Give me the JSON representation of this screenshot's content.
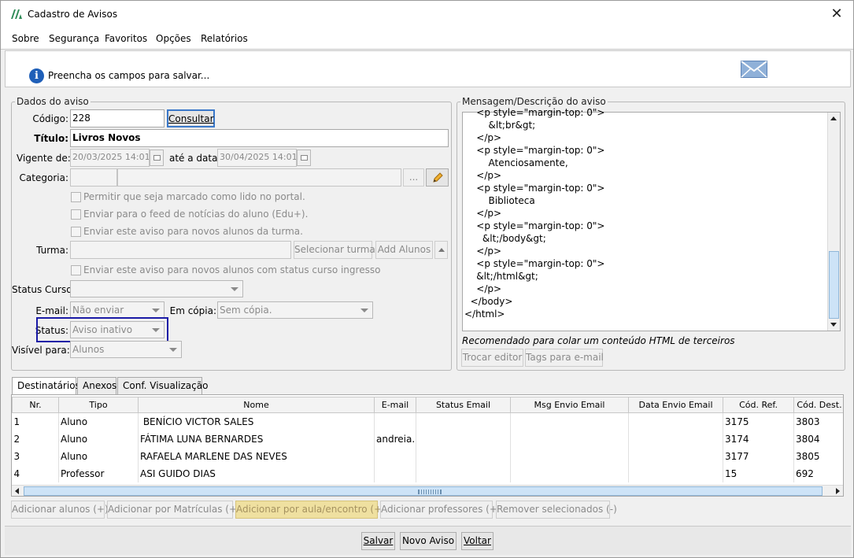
{
  "window": {
    "title": "Cadastro de Avisos",
    "close_symbol": "✕"
  },
  "menu": [
    "Sobre",
    "Segurança",
    "Favoritos",
    "Opções",
    "Relatórios"
  ],
  "header": {
    "message": "Preencha os campos para salvar..."
  },
  "dados": {
    "legend": "Dados do aviso",
    "codigo_label": "Código:",
    "codigo_value": "228",
    "consultar_label": "Consultar",
    "titulo_label": "Título:",
    "titulo_value": "Livros Novos",
    "vigente_label": "Vigente de:",
    "vigente_value": "20/03/2025 14:01",
    "ate_label": "até a data:",
    "ate_value": "30/04/2025 14:01",
    "categoria_label": "Categoria:",
    "ellipsis_label": "...",
    "chk1": "Permitir que seja marcado como lido no portal.",
    "chk2": "Enviar para o feed de notícias do aluno (Edu+).",
    "chk3": "Enviar este aviso para novos alunos da turma.",
    "turma_label": "Turma:",
    "selecionar_turma": "Selecionar turma",
    "add_alunos": "Add Alunos",
    "chk4": "Enviar este aviso para novos alunos com status curso ingresso",
    "status_curso_label": "Status Curso:",
    "email_label": "E-mail:",
    "email_value": "Não enviar",
    "copia_label": "Em cópia:",
    "copia_value": "Sem cópia.",
    "status_label": "Status:",
    "status_value": "Aviso inativo",
    "visivel_label": "Visível para:",
    "visivel_value": "Alunos"
  },
  "mensagem": {
    "legend": "Mensagem/Descrição do aviso",
    "code": "    <p style=\"margin-top: 0\">\n        &lt;br&gt;\n    </p>\n    <p style=\"margin-top: 0\">\n        Atenciosamente,\n    </p>\n    <p style=\"margin-top: 0\">\n        Biblioteca\n    </p>\n    <p style=\"margin-top: 0\">\n      &lt;/body&gt;\n    </p>\n    <p style=\"margin-top: 0\">\n    &lt;/html&gt;\n    </p>\n  </body>\n</html>",
    "hint": "Recomendado para colar um conteúdo HTML de terceiros",
    "trocar_editor": "Trocar editor",
    "tags_email": "Tags para e-mail"
  },
  "tabs": [
    "Destinatários",
    "Anexos",
    "Conf. Visualização"
  ],
  "grid": {
    "columns": [
      "Nr.",
      "Tipo",
      "Nome",
      "E-mail",
      "Status Email",
      "Msg Envio Email",
      "Data Envio Email",
      "Cód. Ref.",
      "Cód. Dest."
    ],
    "rows": [
      [
        "1",
        "Aluno",
        " BENÍCIO VICTOR SALES",
        "",
        "",
        "",
        "",
        "3175",
        "3803"
      ],
      [
        "2",
        "Aluno",
        "FÁTIMA LUNA BERNARDES",
        "andreia...",
        "",
        "",
        "",
        "3174",
        "3804"
      ],
      [
        "3",
        "Aluno",
        "RAFAELA MARLENE DAS NEVES",
        "",
        "",
        "",
        "",
        "3177",
        "3805"
      ],
      [
        "4",
        "Professor",
        "ASI GUIDO DIAS",
        "",
        "",
        "",
        "",
        "15",
        "692"
      ]
    ]
  },
  "grid_buttons": [
    "Adicionar alunos (+)",
    "Adicionar por Matrículas (+)",
    "Adicionar por aula/encontro (+)",
    "Adicionar professores (+)",
    "Remover selecionados (-)"
  ],
  "footer": {
    "salvar": "Salvar",
    "novo_aviso": "Novo Aviso",
    "voltar": "Voltar"
  },
  "colors": {
    "highlight": "#1a1aa6",
    "info_icon": "#1f5fb8",
    "scroll_thumb": "#cde3f7"
  }
}
